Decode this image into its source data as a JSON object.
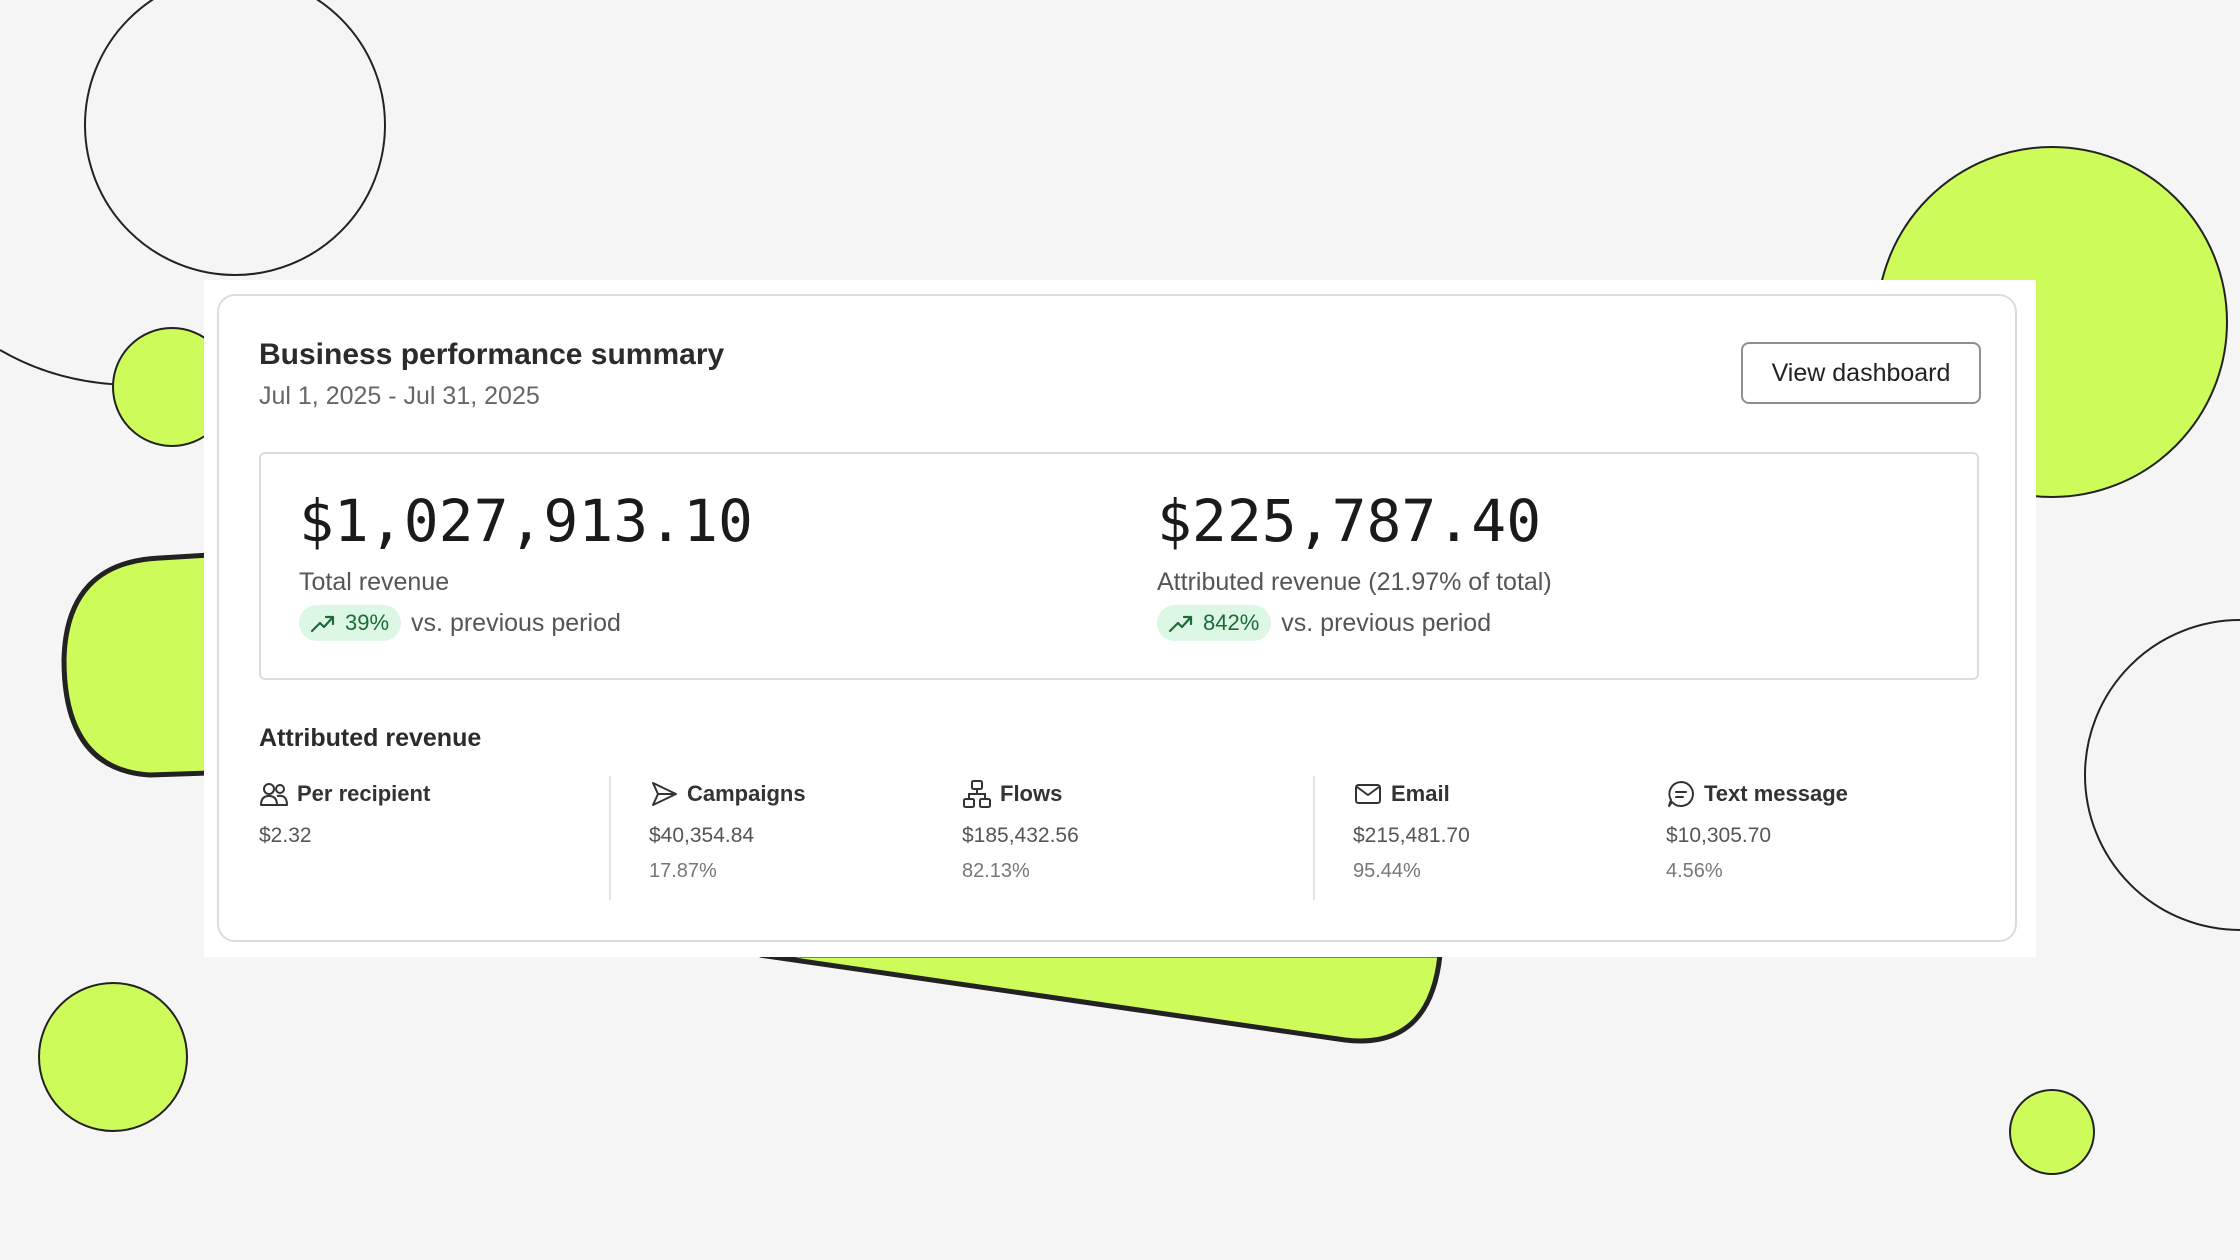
{
  "colors": {
    "accent_lime": "#ccfb5a",
    "outline": "#222222",
    "trend_bg": "#dcf7e4",
    "trend_fg": "#1b6a3a"
  },
  "card": {
    "title": "Business performance summary",
    "date_range": "Jul 1, 2025 - Jul 31, 2025",
    "view_dashboard_label": "View dashboard"
  },
  "summary": {
    "total": {
      "amount": "$1,027,913.10",
      "label": "Total revenue",
      "change": "39%",
      "compare": "vs. previous period",
      "icon": "trend-up-icon"
    },
    "attributed": {
      "amount": "$225,787.40",
      "label": "Attributed revenue (21.97% of total)",
      "change": "842%",
      "compare": "vs. previous period",
      "icon": "trend-up-icon"
    }
  },
  "attributed_revenue": {
    "title": "Attributed revenue",
    "items": [
      {
        "label": "Per recipient",
        "value": "$2.32",
        "icon": "users-icon"
      },
      {
        "label": "Campaigns",
        "value": "$40,354.84",
        "percent": "17.87%",
        "icon": "send-icon"
      },
      {
        "label": "Flows",
        "value": "$185,432.56",
        "percent": "82.13%",
        "icon": "flow-icon"
      },
      {
        "label": "Email",
        "value": "$215,481.70",
        "percent": "95.44%",
        "icon": "mail-icon"
      },
      {
        "label": "Text message",
        "value": "$10,305.70",
        "percent": "4.56%",
        "icon": "message-icon"
      }
    ]
  }
}
